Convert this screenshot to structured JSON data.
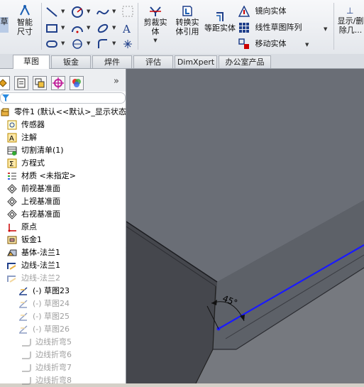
{
  "ribbon": {
    "partial_left": "草",
    "smart_dim": "智能尺寸",
    "trim": "剪裁实体",
    "convert": "转换实体引用",
    "offset": "等距实体",
    "mirror": "镜向实体",
    "linear_pattern": "线性草图阵列",
    "move": "移动实体",
    "display": "显示/删除几..."
  },
  "tabs": [
    "草图",
    "钣金",
    "焊件",
    "评估",
    "DimXpert",
    "办公室产品"
  ],
  "active_tab": "草图",
  "panel": {
    "tabs_icons": [
      "feature-manager-icon",
      "property-manager-icon",
      "configuration-manager-icon",
      "dimxpert-manager-icon",
      "display-manager-icon"
    ],
    "more": "»"
  },
  "tree": [
    {
      "label": "零件1  (默认<<默认>_显示状态",
      "icon": "part-icon",
      "state": "normal"
    },
    {
      "label": "传感器",
      "icon": "sensor-icon",
      "state": "normal"
    },
    {
      "label": "注解",
      "icon": "annotation-icon",
      "state": "normal"
    },
    {
      "label": "切割清单(1)",
      "icon": "cut-list-icon",
      "state": "normal"
    },
    {
      "label": "方程式",
      "icon": "equation-icon",
      "state": "normal"
    },
    {
      "label": "材质 <未指定>",
      "icon": "material-icon",
      "state": "normal"
    },
    {
      "label": "前视基准面",
      "icon": "plane-icon",
      "state": "normal"
    },
    {
      "label": "上视基准面",
      "icon": "plane-icon",
      "state": "normal"
    },
    {
      "label": "右视基准面",
      "icon": "plane-icon",
      "state": "normal"
    },
    {
      "label": "原点",
      "icon": "origin-icon",
      "state": "normal"
    },
    {
      "label": "钣金1",
      "icon": "sheet-metal-icon",
      "state": "normal"
    },
    {
      "label": "基体-法兰1",
      "icon": "base-flange-icon",
      "state": "normal"
    },
    {
      "label": "边线-法兰1",
      "icon": "edge-flange-icon",
      "state": "normal"
    },
    {
      "label": "边线-法兰2",
      "icon": "edge-flange-icon",
      "state": "grey"
    },
    {
      "label": "(-) 草图23",
      "icon": "sketch-icon",
      "state": "normal"
    },
    {
      "label": "(-) 草图24",
      "icon": "sketch-icon",
      "state": "grey"
    },
    {
      "label": "(-) 草图25",
      "icon": "sketch-icon",
      "state": "grey"
    },
    {
      "label": "(-) 草图26",
      "icon": "sketch-icon",
      "state": "grey"
    },
    {
      "label": "边线折弯5",
      "icon": "bend-icon",
      "state": "grey"
    },
    {
      "label": "边线折弯6",
      "icon": "bend-icon",
      "state": "grey"
    },
    {
      "label": "边线折弯7",
      "icon": "bend-icon",
      "state": "grey"
    },
    {
      "label": "边线折弯8",
      "icon": "bend-icon",
      "state": "grey"
    }
  ],
  "viewport": {
    "angle_label": "45°",
    "sketch_line_color": "#1a1aff",
    "background_color": "#4e5159"
  }
}
